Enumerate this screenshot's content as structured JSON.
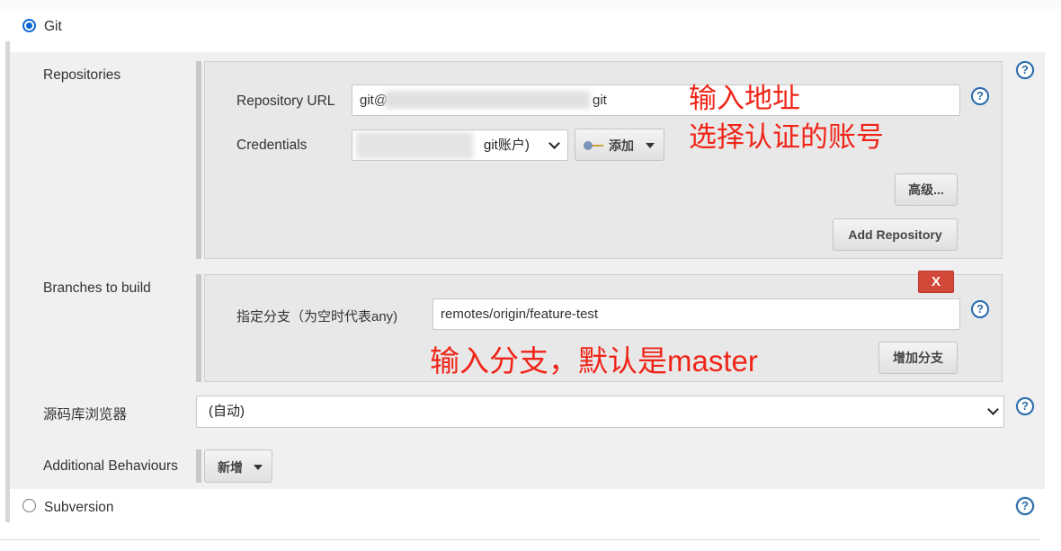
{
  "scm": {
    "git_label": "Git",
    "svn_label": "Subversion"
  },
  "repositories": {
    "label": "Repositories",
    "url_label": "Repository URL",
    "url_prefix": "git@",
    "url_suffix": "git",
    "credentials_label": "Credentials",
    "credentials_value": "git账户)",
    "add_button": "添加",
    "advanced_button": "高级...",
    "add_repository_button": "Add Repository"
  },
  "branches": {
    "label": "Branches to build",
    "delete_button": "X",
    "branch_label": "指定分支（为空时代表any)",
    "branch_value": "remotes/origin/feature-test",
    "add_branch_button": "增加分支"
  },
  "browser": {
    "label": "源码库浏览器",
    "value": "(自动)"
  },
  "behaviours": {
    "label": "Additional Behaviours",
    "add_button": "新增"
  },
  "annotations": {
    "address": "输入地址",
    "account": "选择认证的账号",
    "branch": "输入分支，默认是master"
  },
  "help_icon_text": "?",
  "colors": {
    "annotation": "#f02518",
    "radio_accent": "#0a66d9",
    "help_icon": "#2b6aa8",
    "delete_button": "#d24939"
  }
}
